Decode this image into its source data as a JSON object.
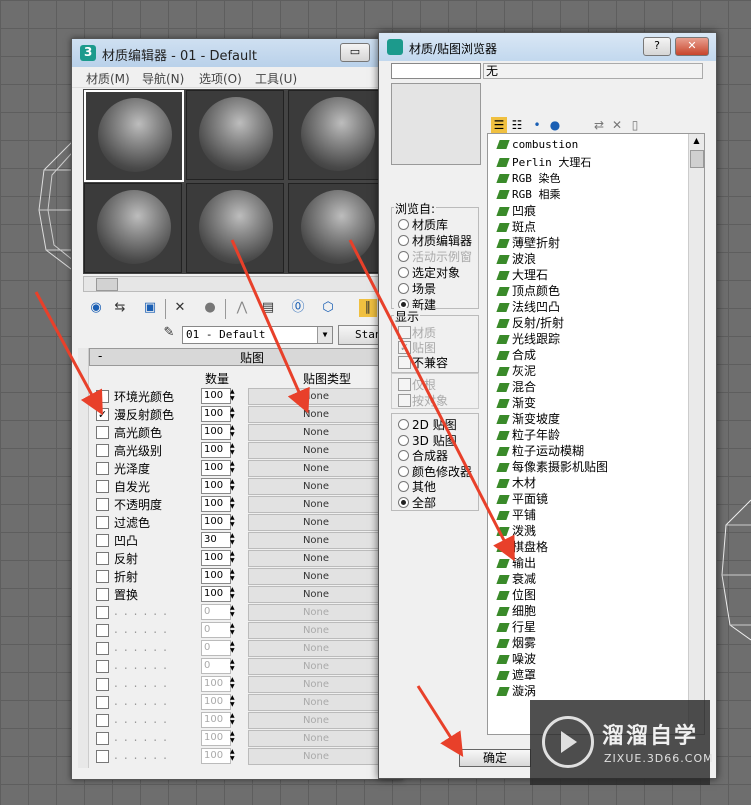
{
  "material_editor": {
    "title": "材质编辑器 - 01 - Default",
    "menu": [
      "材质(M)",
      "导航(N)",
      "选项(O)",
      "工具(U)"
    ],
    "material_name": "01 - Default",
    "type_button": "Standard",
    "rollout_title": "贴图",
    "col_amount": "数量",
    "col_maptype": "贴图类型",
    "maps": [
      {
        "label": "环境光颜色",
        "checked": false,
        "amount": "100",
        "map": "None"
      },
      {
        "label": "漫反射颜色",
        "checked": true,
        "amount": "100",
        "map": "None"
      },
      {
        "label": "高光颜色",
        "checked": false,
        "amount": "100",
        "map": "None"
      },
      {
        "label": "高光级别",
        "checked": false,
        "amount": "100",
        "map": "None"
      },
      {
        "label": "光泽度",
        "checked": false,
        "amount": "100",
        "map": "None"
      },
      {
        "label": "自发光",
        "checked": false,
        "amount": "100",
        "map": "None"
      },
      {
        "label": "不透明度",
        "checked": false,
        "amount": "100",
        "map": "None"
      },
      {
        "label": "过滤色",
        "checked": false,
        "amount": "100",
        "map": "None"
      },
      {
        "label": "凹凸",
        "checked": false,
        "amount": "30",
        "map": "None"
      },
      {
        "label": "反射",
        "checked": false,
        "amount": "100",
        "map": "None"
      },
      {
        "label": "折射",
        "checked": false,
        "amount": "100",
        "map": "None"
      },
      {
        "label": "置换",
        "checked": false,
        "amount": "100",
        "map": "None"
      },
      {
        "label": "",
        "checked": false,
        "amount": "0",
        "map": "None"
      },
      {
        "label": "",
        "checked": false,
        "amount": "0",
        "map": "None"
      },
      {
        "label": "",
        "checked": false,
        "amount": "0",
        "map": "None"
      },
      {
        "label": "",
        "checked": false,
        "amount": "0",
        "map": "None"
      },
      {
        "label": "",
        "checked": false,
        "amount": "100",
        "map": "None"
      },
      {
        "label": "",
        "checked": false,
        "amount": "100",
        "map": "None"
      },
      {
        "label": "",
        "checked": false,
        "amount": "100",
        "map": "None"
      },
      {
        "label": "",
        "checked": false,
        "amount": "100",
        "map": "None"
      },
      {
        "label": "",
        "checked": false,
        "amount": "100",
        "map": "None"
      }
    ]
  },
  "browser": {
    "title": "材质/贴图浏览器",
    "help_label": "?",
    "close_label": "✕",
    "none_label": "无",
    "browse_from_label": "浏览自:",
    "browse_from": [
      {
        "label": "材质库",
        "on": false,
        "dim": false
      },
      {
        "label": "材质编辑器",
        "on": false,
        "dim": false
      },
      {
        "label": "活动示例窗",
        "on": false,
        "dim": true
      },
      {
        "label": "选定对象",
        "on": false,
        "dim": false
      },
      {
        "label": "场景",
        "on": false,
        "dim": false
      },
      {
        "label": "新建",
        "on": true,
        "dim": false
      }
    ],
    "show_label": "显示",
    "show": [
      {
        "label": "材质",
        "checked": false,
        "dim": true
      },
      {
        "label": "贴图",
        "checked": true,
        "dim": true
      },
      {
        "label": "不兼容",
        "checked": false,
        "dim": false
      }
    ],
    "extra": [
      {
        "label": "仅根",
        "dim": true
      },
      {
        "label": "按对象",
        "dim": true
      }
    ],
    "filters": [
      {
        "label": "2D 贴图",
        "on": false
      },
      {
        "label": "3D 贴图",
        "on": false
      },
      {
        "label": "合成器",
        "on": false
      },
      {
        "label": "颜色修改器",
        "on": false
      },
      {
        "label": "其他",
        "on": false
      },
      {
        "label": "全部",
        "on": true
      }
    ],
    "items": [
      "combustion",
      "Perlin 大理石",
      "RGB 染色",
      "RGB 相乘",
      "凹痕",
      "斑点",
      "薄壁折射",
      "波浪",
      "大理石",
      "顶点颜色",
      "法线凹凸",
      "反射/折射",
      "光线跟踪",
      "合成",
      "灰泥",
      "混合",
      "渐变",
      "渐变坡度",
      "粒子年龄",
      "粒子运动模糊",
      "每像素摄影机贴图",
      "木材",
      "平面镜",
      "平铺",
      "泼溅",
      "棋盘格",
      "输出",
      "衰减",
      "位图",
      "细胞",
      "行星",
      "烟雾",
      "噪波",
      "遮罩",
      "漩涡"
    ],
    "ok_label": "确定"
  },
  "watermark": {
    "brand": "溜溜自学",
    "url": "ZIXUE.3D66.COM"
  },
  "colors": {
    "arrow": "#e8402a",
    "map_icon": "#3a8a2a"
  }
}
